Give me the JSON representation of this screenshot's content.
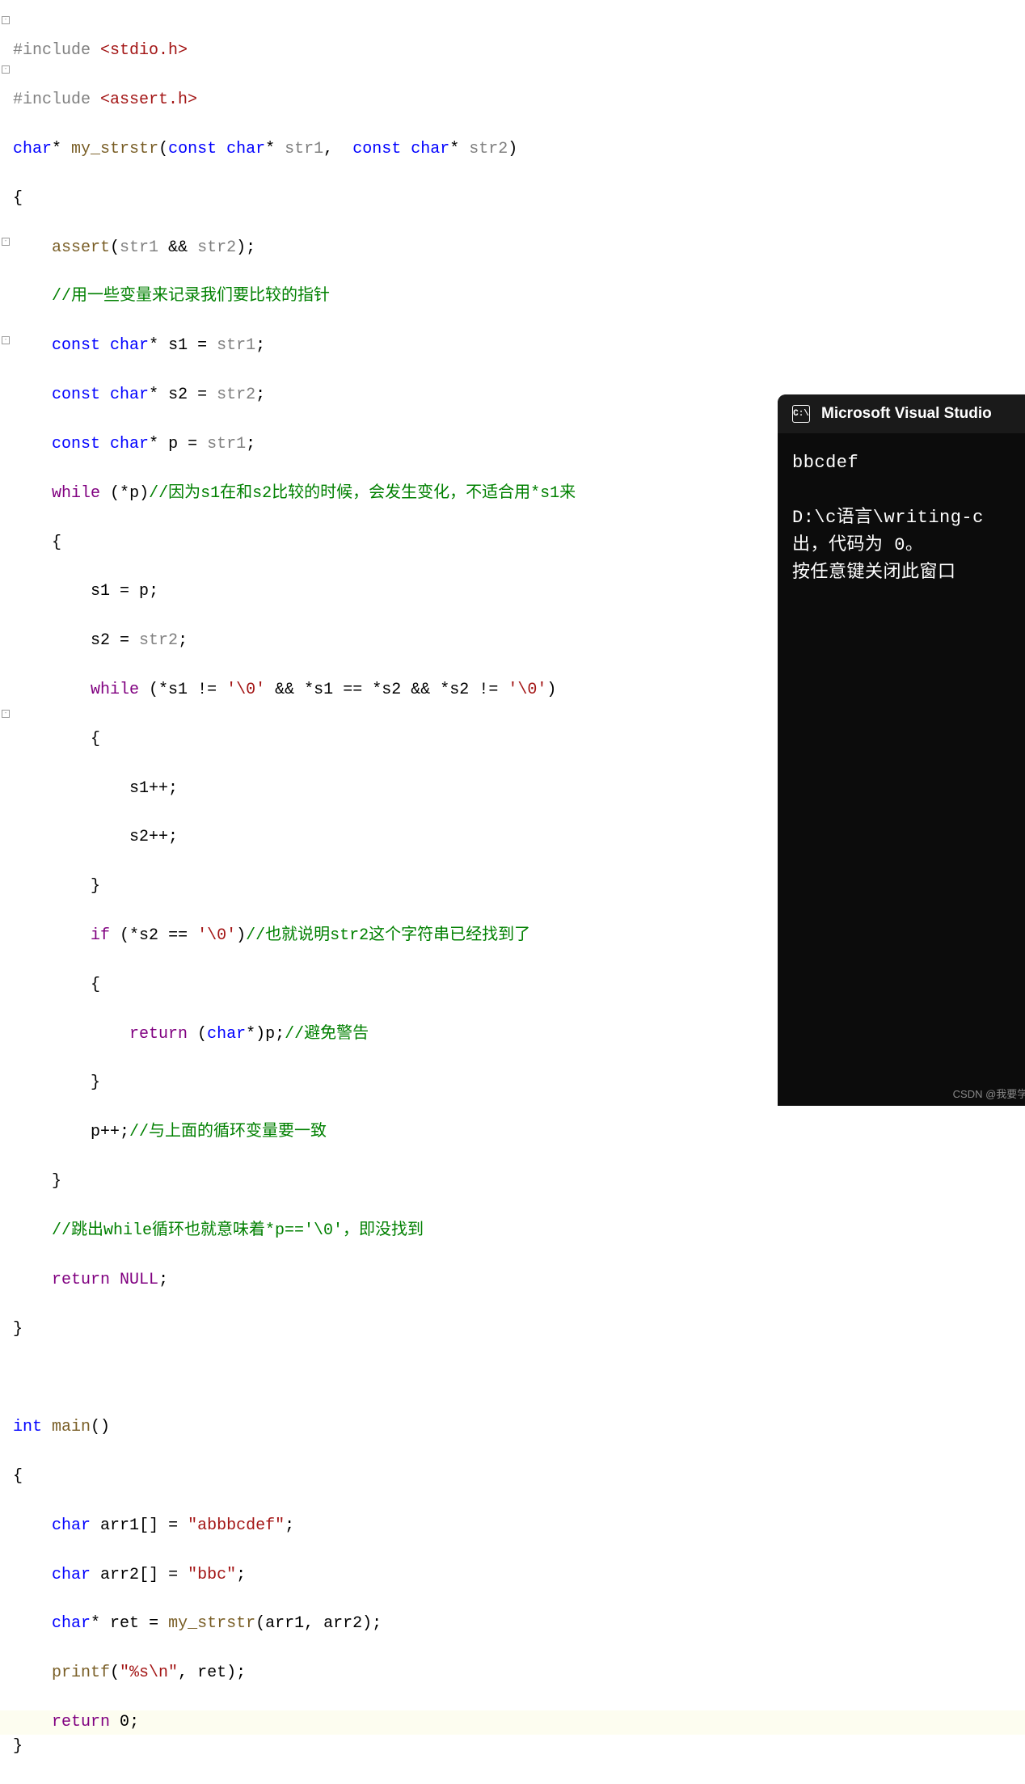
{
  "code": {
    "l1_inc": "#include",
    "l1_hdr": "<stdio.h>",
    "l2_inc": "#include",
    "l2_hdr": "<assert.h>",
    "l3_char": "char",
    "l3_star": "*",
    "l3_fn": "my_strstr",
    "l3_const1": "const",
    "l3_char2": "char",
    "l3_p1": "str1",
    "l3_const2": "const",
    "l3_char3": "char",
    "l3_p2": "str2",
    "l5_assert": "assert",
    "l5_a1": "str1",
    "l5_amp": "&&",
    "l5_a2": "str2",
    "l6_cmt": "//用一些变量来记录我们要比较的指针",
    "l7_const": "const",
    "l7_char": "char",
    "l7_s1": "s1",
    "l7_eq": "=",
    "l7_v": "str1",
    "l8_const": "const",
    "l8_char": "char",
    "l8_s2": "s2",
    "l8_v": "str2",
    "l9_const": "const",
    "l9_char": "char",
    "l9_p": "p",
    "l9_v": "str1",
    "l10_while": "while",
    "l10_star": "*",
    "l10_p": "p",
    "l10_cmt": "//因为s1在和s2比较的时候，会发生变化，不适合用*s1来",
    "l12_s1": "s1",
    "l12_p": "p",
    "l13_s2": "s2",
    "l13_v": "str2",
    "l14_while": "while",
    "l14_s1a": "*s1",
    "l14_ne1": "!=",
    "l14_c1": "'\\0'",
    "l14_and1": "&&",
    "l14_s1b": "*s1",
    "l14_eq": "==",
    "l14_s2a": "*s2",
    "l14_and2": "&&",
    "l14_s2b": "*s2",
    "l14_ne2": "!=",
    "l14_c2": "'\\0'",
    "l16_s1pp": "s1++;",
    "l17_s2pp": "s2++;",
    "l19_if": "if",
    "l19_s2": "*s2",
    "l19_eq": "==",
    "l19_c": "'\\0'",
    "l19_cmt": "//也就说明str2这个字符串已经找到了",
    "l21_return": "return",
    "l21_char": "char",
    "l21_p": "p",
    "l21_cmt": "//避免警告",
    "l23_ppp": "p++;",
    "l23_cmt": "//与上面的循环变量要一致",
    "l25_cmt": "//跳出while循环也就意味着*p=='\\0'，即没找到",
    "l26_return": "return",
    "l26_null": "NULL",
    "main_int": "int",
    "main_fn": "main",
    "m1_char": "char",
    "m1_arr": "arr1",
    "m1_str": "\"abbbcdef\"",
    "m2_char": "char",
    "m2_arr": "arr2",
    "m2_str": "\"bbc\"",
    "m3_char": "char",
    "m3_ret": "ret",
    "m3_fn": "my_strstr",
    "m3_a1": "arr1",
    "m3_a2": "arr2",
    "m4_printf": "printf",
    "m4_fmt": "\"%s\\n\"",
    "m4_ret": "ret",
    "m5_return": "return",
    "m5_zero": "0"
  },
  "console": {
    "title": "Microsoft Visual Studio ",
    "icon_text": "C:\\",
    "out1": "bbcdef",
    "out2": "D:\\c语言\\writing-c",
    "out3": "出，代码为 0。",
    "out4": "按任意键关闭此窗口"
  },
  "watermark": "CSDN @我要学编程(ಥ_ಥ)"
}
